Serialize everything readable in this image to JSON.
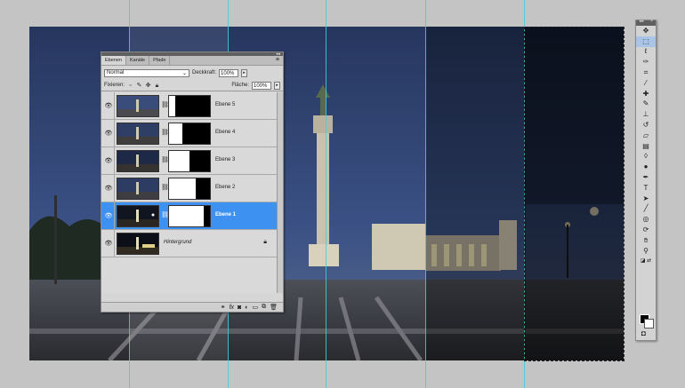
{
  "layers_panel": {
    "tabs": [
      "Ebenen",
      "Kanäle",
      "Pfade"
    ],
    "blend_mode": "Normal",
    "opacity_label": "Deckkraft:",
    "opacity_value": "100%",
    "lock_label": "Fixieren:",
    "fill_label": "Fläche:",
    "fill_value": "100%",
    "layers": [
      {
        "name": "Ebene 5",
        "mask_white_fraction": 0.15
      },
      {
        "name": "Ebene 4",
        "mask_white_fraction": 0.33
      },
      {
        "name": "Ebene 3",
        "mask_white_fraction": 0.5
      },
      {
        "name": "Ebene 2",
        "mask_white_fraction": 0.66
      },
      {
        "name": "Ebene 1",
        "mask_white_fraction": 0.85,
        "selected": true
      },
      {
        "name": "Hintergrund",
        "italic": true,
        "locked": true
      }
    ],
    "footer_icons": [
      "link-icon",
      "fx-icon",
      "mask-icon",
      "adjustment-icon",
      "folder-icon",
      "new-layer-icon",
      "trash-icon"
    ]
  },
  "tools": [
    "move",
    "marquee",
    "lasso",
    "quick-select",
    "crop",
    "eyedropper",
    "healing",
    "brush",
    "stamp",
    "history-brush",
    "eraser",
    "gradient",
    "blur",
    "dodge",
    "pen",
    "type",
    "path-select",
    "shape",
    "3d-rotate",
    "3d-orbit",
    "hand",
    "zoom"
  ],
  "colors": {
    "selection": "#3d91f0",
    "guide": "#3fd0dc",
    "workspace": "#c4c4c4"
  }
}
